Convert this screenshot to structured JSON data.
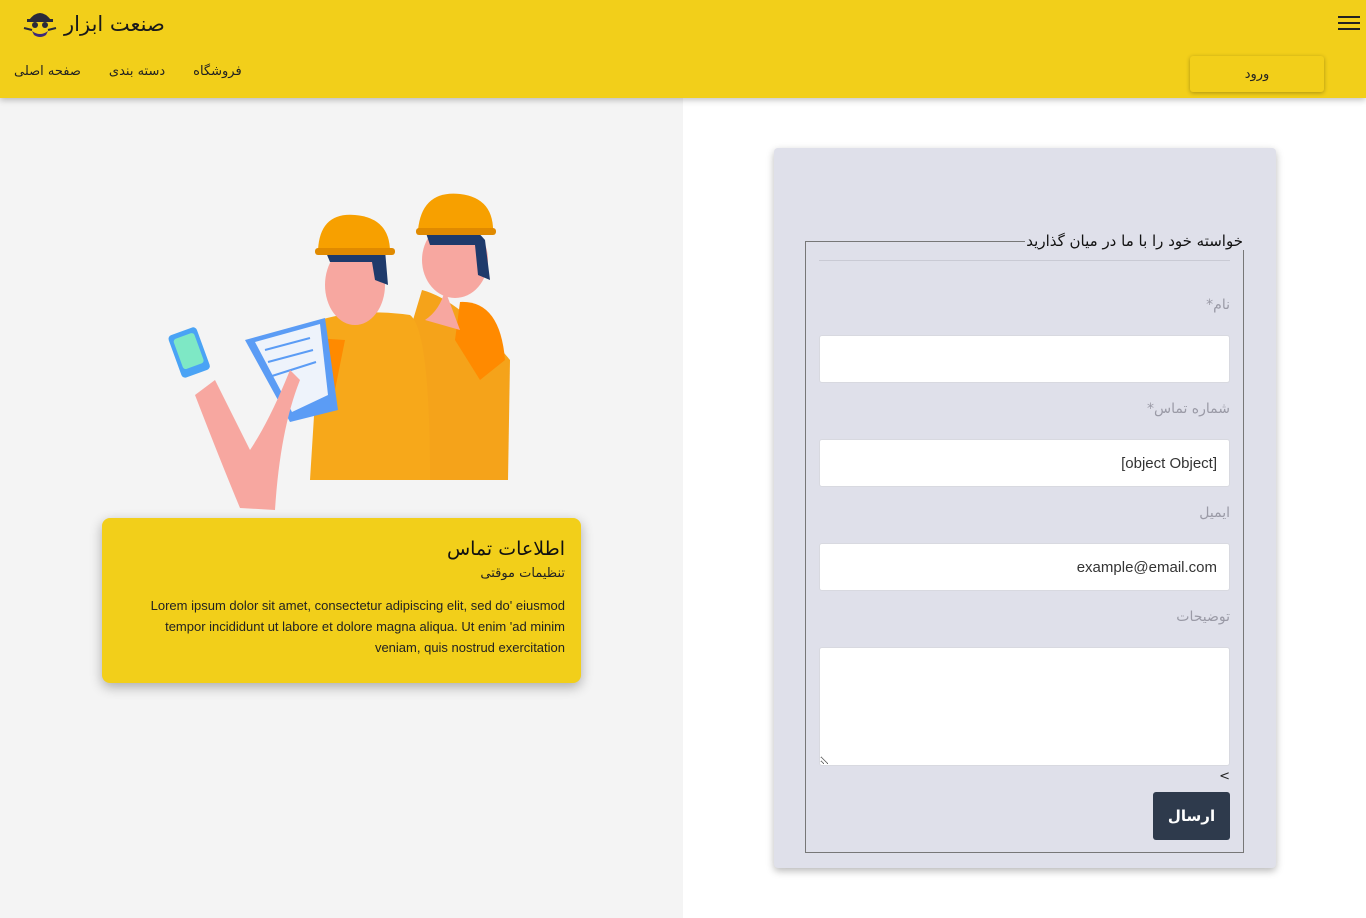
{
  "header": {
    "brand_title": "صنعت ابزار",
    "brand_logo_icon": "worker-helmet-logo-icon",
    "menu_icon": "hamburger-menu-icon",
    "nav": {
      "home": "صفحه اصلی",
      "categories": "دسته بندی",
      "shop": "فروشگاه"
    },
    "login_label": "ورود",
    "color": "#f2cf1a"
  },
  "contact_card": {
    "title": "اطلاعات تماس",
    "subtitle": "تنظیمات موقتی",
    "body": "Lorem ipsum dolor sit amet, consectetur adipiscing elit, sed do' eiusmod tempor incididunt ut labore et dolore magna aliqua. Ut enim 'ad minim veniam, quis nostrud exercitation"
  },
  "form": {
    "legend": "خواسته خود را با ما در میان گذارید",
    "name_label": "نام*",
    "name_value": "",
    "phone_label": "شماره تماس*",
    "phone_value": "[object Object]",
    "email_label": "ایمیل",
    "email_value": "example@email.com",
    "desc_label": "توضیحات",
    "desc_value": "",
    "char_mark": ">",
    "submit_label": "ارسال",
    "submit_color": "#2e3a4c"
  }
}
